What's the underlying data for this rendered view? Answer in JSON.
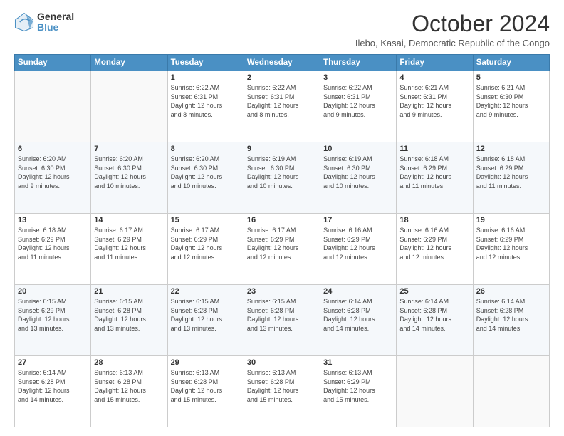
{
  "logo": {
    "general": "General",
    "blue": "Blue"
  },
  "title": "October 2024",
  "subtitle": "Ilebo, Kasai, Democratic Republic of the Congo",
  "headers": [
    "Sunday",
    "Monday",
    "Tuesday",
    "Wednesday",
    "Thursday",
    "Friday",
    "Saturday"
  ],
  "weeks": [
    [
      {
        "day": "",
        "info": ""
      },
      {
        "day": "",
        "info": ""
      },
      {
        "day": "1",
        "info": "Sunrise: 6:22 AM\nSunset: 6:31 PM\nDaylight: 12 hours\nand 8 minutes."
      },
      {
        "day": "2",
        "info": "Sunrise: 6:22 AM\nSunset: 6:31 PM\nDaylight: 12 hours\nand 8 minutes."
      },
      {
        "day": "3",
        "info": "Sunrise: 6:22 AM\nSunset: 6:31 PM\nDaylight: 12 hours\nand 9 minutes."
      },
      {
        "day": "4",
        "info": "Sunrise: 6:21 AM\nSunset: 6:31 PM\nDaylight: 12 hours\nand 9 minutes."
      },
      {
        "day": "5",
        "info": "Sunrise: 6:21 AM\nSunset: 6:30 PM\nDaylight: 12 hours\nand 9 minutes."
      }
    ],
    [
      {
        "day": "6",
        "info": "Sunrise: 6:20 AM\nSunset: 6:30 PM\nDaylight: 12 hours\nand 9 minutes."
      },
      {
        "day": "7",
        "info": "Sunrise: 6:20 AM\nSunset: 6:30 PM\nDaylight: 12 hours\nand 10 minutes."
      },
      {
        "day": "8",
        "info": "Sunrise: 6:20 AM\nSunset: 6:30 PM\nDaylight: 12 hours\nand 10 minutes."
      },
      {
        "day": "9",
        "info": "Sunrise: 6:19 AM\nSunset: 6:30 PM\nDaylight: 12 hours\nand 10 minutes."
      },
      {
        "day": "10",
        "info": "Sunrise: 6:19 AM\nSunset: 6:30 PM\nDaylight: 12 hours\nand 10 minutes."
      },
      {
        "day": "11",
        "info": "Sunrise: 6:18 AM\nSunset: 6:29 PM\nDaylight: 12 hours\nand 11 minutes."
      },
      {
        "day": "12",
        "info": "Sunrise: 6:18 AM\nSunset: 6:29 PM\nDaylight: 12 hours\nand 11 minutes."
      }
    ],
    [
      {
        "day": "13",
        "info": "Sunrise: 6:18 AM\nSunset: 6:29 PM\nDaylight: 12 hours\nand 11 minutes."
      },
      {
        "day": "14",
        "info": "Sunrise: 6:17 AM\nSunset: 6:29 PM\nDaylight: 12 hours\nand 11 minutes."
      },
      {
        "day": "15",
        "info": "Sunrise: 6:17 AM\nSunset: 6:29 PM\nDaylight: 12 hours\nand 12 minutes."
      },
      {
        "day": "16",
        "info": "Sunrise: 6:17 AM\nSunset: 6:29 PM\nDaylight: 12 hours\nand 12 minutes."
      },
      {
        "day": "17",
        "info": "Sunrise: 6:16 AM\nSunset: 6:29 PM\nDaylight: 12 hours\nand 12 minutes."
      },
      {
        "day": "18",
        "info": "Sunrise: 6:16 AM\nSunset: 6:29 PM\nDaylight: 12 hours\nand 12 minutes."
      },
      {
        "day": "19",
        "info": "Sunrise: 6:16 AM\nSunset: 6:29 PM\nDaylight: 12 hours\nand 12 minutes."
      }
    ],
    [
      {
        "day": "20",
        "info": "Sunrise: 6:15 AM\nSunset: 6:29 PM\nDaylight: 12 hours\nand 13 minutes."
      },
      {
        "day": "21",
        "info": "Sunrise: 6:15 AM\nSunset: 6:28 PM\nDaylight: 12 hours\nand 13 minutes."
      },
      {
        "day": "22",
        "info": "Sunrise: 6:15 AM\nSunset: 6:28 PM\nDaylight: 12 hours\nand 13 minutes."
      },
      {
        "day": "23",
        "info": "Sunrise: 6:15 AM\nSunset: 6:28 PM\nDaylight: 12 hours\nand 13 minutes."
      },
      {
        "day": "24",
        "info": "Sunrise: 6:14 AM\nSunset: 6:28 PM\nDaylight: 12 hours\nand 14 minutes."
      },
      {
        "day": "25",
        "info": "Sunrise: 6:14 AM\nSunset: 6:28 PM\nDaylight: 12 hours\nand 14 minutes."
      },
      {
        "day": "26",
        "info": "Sunrise: 6:14 AM\nSunset: 6:28 PM\nDaylight: 12 hours\nand 14 minutes."
      }
    ],
    [
      {
        "day": "27",
        "info": "Sunrise: 6:14 AM\nSunset: 6:28 PM\nDaylight: 12 hours\nand 14 minutes."
      },
      {
        "day": "28",
        "info": "Sunrise: 6:13 AM\nSunset: 6:28 PM\nDaylight: 12 hours\nand 15 minutes."
      },
      {
        "day": "29",
        "info": "Sunrise: 6:13 AM\nSunset: 6:28 PM\nDaylight: 12 hours\nand 15 minutes."
      },
      {
        "day": "30",
        "info": "Sunrise: 6:13 AM\nSunset: 6:28 PM\nDaylight: 12 hours\nand 15 minutes."
      },
      {
        "day": "31",
        "info": "Sunrise: 6:13 AM\nSunset: 6:29 PM\nDaylight: 12 hours\nand 15 minutes."
      },
      {
        "day": "",
        "info": ""
      },
      {
        "day": "",
        "info": ""
      }
    ]
  ]
}
